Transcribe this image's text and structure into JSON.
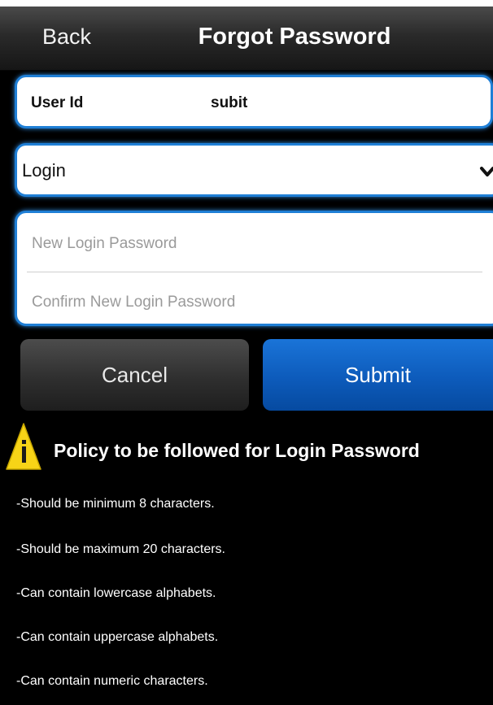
{
  "header": {
    "back_label": "Back",
    "title": "Forgot Password"
  },
  "user": {
    "label": "User Id",
    "value": "subit"
  },
  "password_type": {
    "selected": "Login",
    "icon": "chevron-down-icon"
  },
  "password_fields": {
    "new_placeholder": "New Login Password",
    "confirm_placeholder": "Confirm New Login Password"
  },
  "actions": {
    "cancel_label": "Cancel",
    "submit_label": "Submit"
  },
  "policy": {
    "icon": "warning-info-icon",
    "title": "Policy to be followed for Login Password",
    "rules": [
      "-Should be minimum 8 characters.",
      "-Should be maximum 20 characters.",
      "-Can contain lowercase alphabets.",
      "-Can contain uppercase alphabets.",
      "-Can contain numeric characters."
    ]
  },
  "colors": {
    "accent": "#1f7fd6",
    "submit": "#0d5bbb",
    "warning": "#f7d417",
    "background": "#000000"
  }
}
